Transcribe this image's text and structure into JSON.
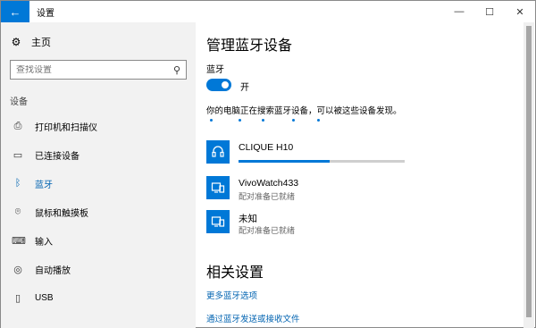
{
  "window": {
    "title": "设置",
    "back_glyph": "←",
    "minimize_glyph": "—",
    "maximize_glyph": "☐",
    "close_glyph": "✕"
  },
  "sidebar": {
    "home_label": "主页",
    "search_placeholder": "查找设置",
    "section_label": "设备",
    "items": [
      {
        "label": "打印机和扫描仪",
        "icon": "printer-icon",
        "glyph": "⎙",
        "active": false
      },
      {
        "label": "已连接设备",
        "icon": "connected-devices-icon",
        "glyph": "▭",
        "active": false
      },
      {
        "label": "蓝牙",
        "icon": "bluetooth-icon",
        "glyph": "ᛒ",
        "active": true
      },
      {
        "label": "鼠标和触摸板",
        "icon": "mouse-icon",
        "glyph": "⌾",
        "active": false
      },
      {
        "label": "输入",
        "icon": "keyboard-icon",
        "glyph": "⌨",
        "active": false
      },
      {
        "label": "自动播放",
        "icon": "autoplay-icon",
        "glyph": "◎",
        "active": false
      },
      {
        "label": "USB",
        "icon": "usb-icon",
        "glyph": "▯",
        "active": false
      }
    ]
  },
  "main": {
    "title": "管理蓝牙设备",
    "bluetooth_label": "蓝牙",
    "toggle_state": "开",
    "searching_text": "你的电脑正在搜索蓝牙设备，可以被这些设备发现。",
    "devices": [
      {
        "name": "CLIQUE H10",
        "status": "",
        "icon": "headset-icon",
        "progress": 0.55
      },
      {
        "name": "VivoWatch433",
        "status": "配对准备已就绪",
        "icon": "device-icon"
      },
      {
        "name": "未知",
        "status": "配对准备已就绪",
        "icon": "device-icon"
      }
    ],
    "related_title": "相关设置",
    "links": [
      "更多蓝牙选项",
      "通过蓝牙发送或接收文件"
    ]
  },
  "colors": {
    "accent": "#0078d7",
    "link": "#0063b1",
    "sidebar_bg": "#f2f2f2"
  }
}
